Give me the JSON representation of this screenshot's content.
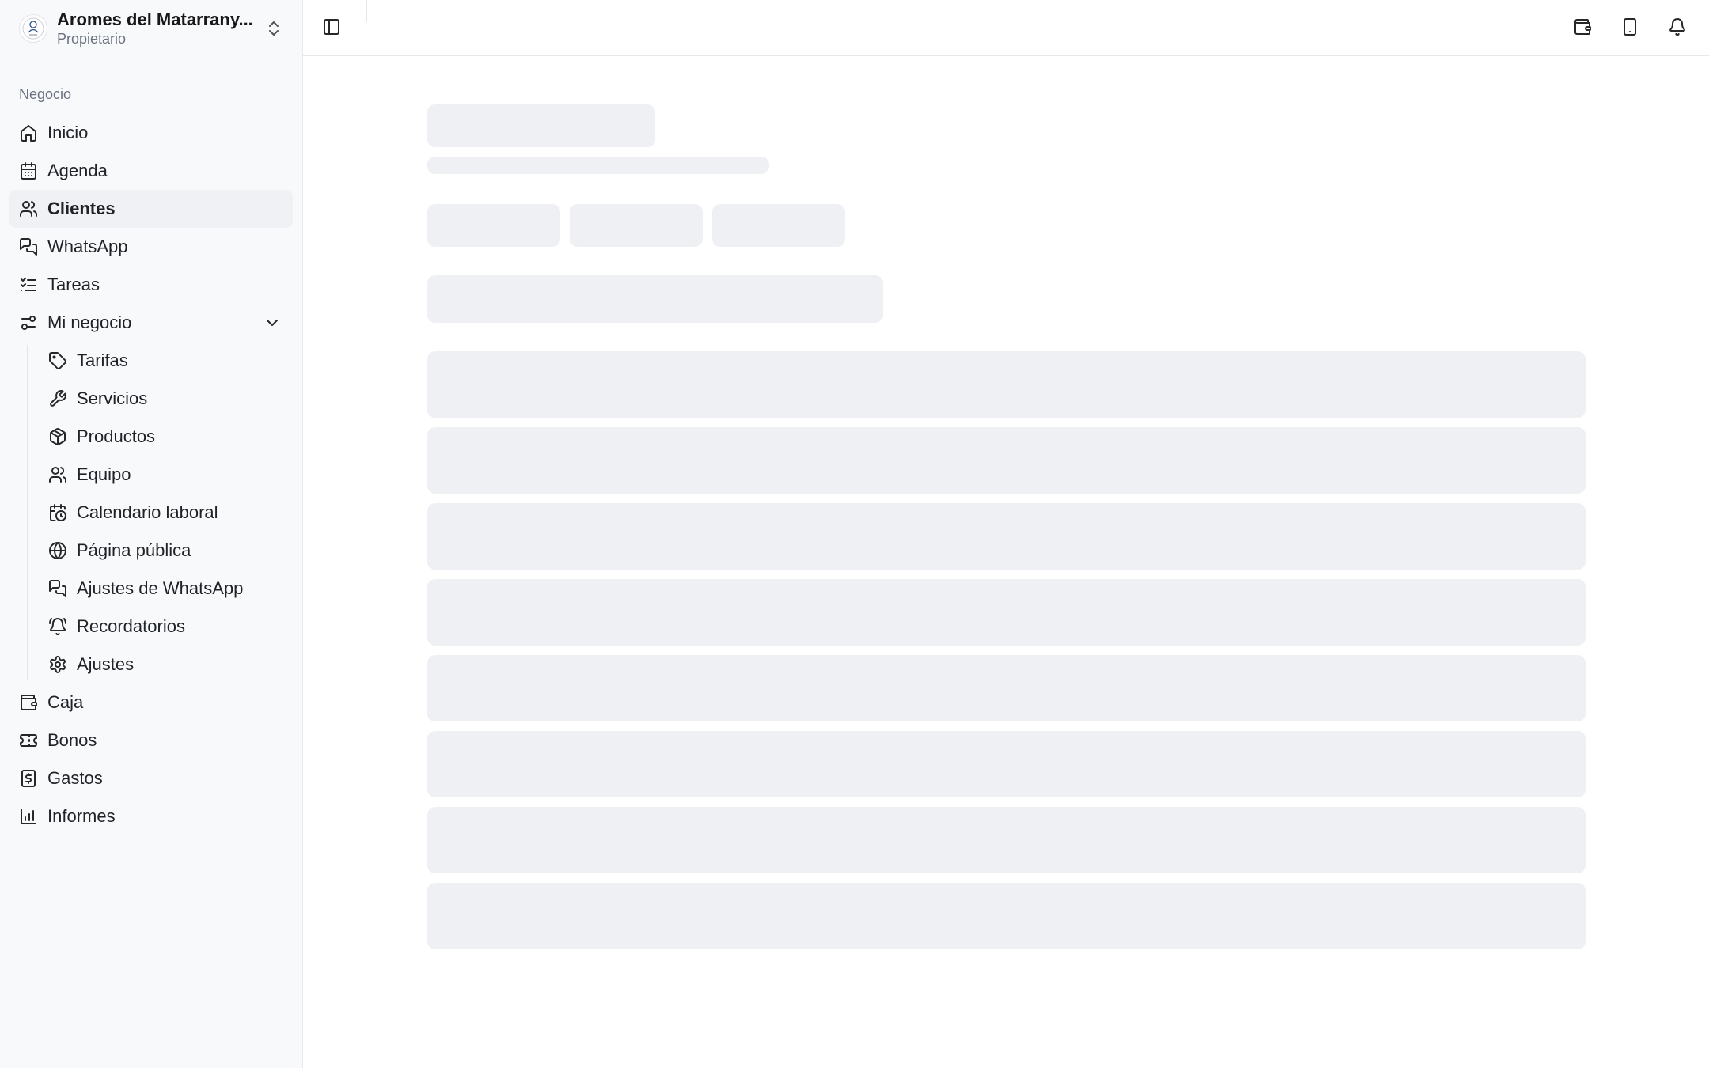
{
  "business": {
    "name": "Aromes del Matarrany...",
    "role": "Propietario"
  },
  "sidebar": {
    "section_label": "Negocio",
    "items": [
      {
        "label": "Inicio",
        "icon": "home-icon"
      },
      {
        "label": "Agenda",
        "icon": "calendar-icon"
      },
      {
        "label": "Clientes",
        "icon": "users-icon",
        "active": true
      },
      {
        "label": "WhatsApp",
        "icon": "chat-icon"
      },
      {
        "label": "Tareas",
        "icon": "list-checks-icon"
      },
      {
        "label": "Mi negocio",
        "icon": "settings-sliders-icon",
        "expanded": true
      }
    ],
    "subitems": [
      {
        "label": "Tarifas",
        "icon": "tag-icon"
      },
      {
        "label": "Servicios",
        "icon": "wrench-icon"
      },
      {
        "label": "Productos",
        "icon": "package-icon"
      },
      {
        "label": "Equipo",
        "icon": "users-icon"
      },
      {
        "label": "Calendario laboral",
        "icon": "calendar-clock-icon"
      },
      {
        "label": "Página pública",
        "icon": "globe-icon"
      },
      {
        "label": "Ajustes de WhatsApp",
        "icon": "chat-icon"
      },
      {
        "label": "Recordatorios",
        "icon": "bell-ring-icon"
      },
      {
        "label": "Ajustes",
        "icon": "gear-icon"
      }
    ],
    "bottom_items": [
      {
        "label": "Caja",
        "icon": "wallet-icon"
      },
      {
        "label": "Bonos",
        "icon": "ticket-icon"
      },
      {
        "label": "Gastos",
        "icon": "receipt-icon"
      },
      {
        "label": "Informes",
        "icon": "bar-chart-icon"
      }
    ]
  },
  "topbar": {
    "actions": [
      "wallet-icon",
      "tablet-icon",
      "bell-icon"
    ]
  },
  "colors": {
    "sidebar_bg": "#f8f9fb",
    "skeleton": "#eef0f3",
    "active_bg": "#f0f1f4"
  }
}
